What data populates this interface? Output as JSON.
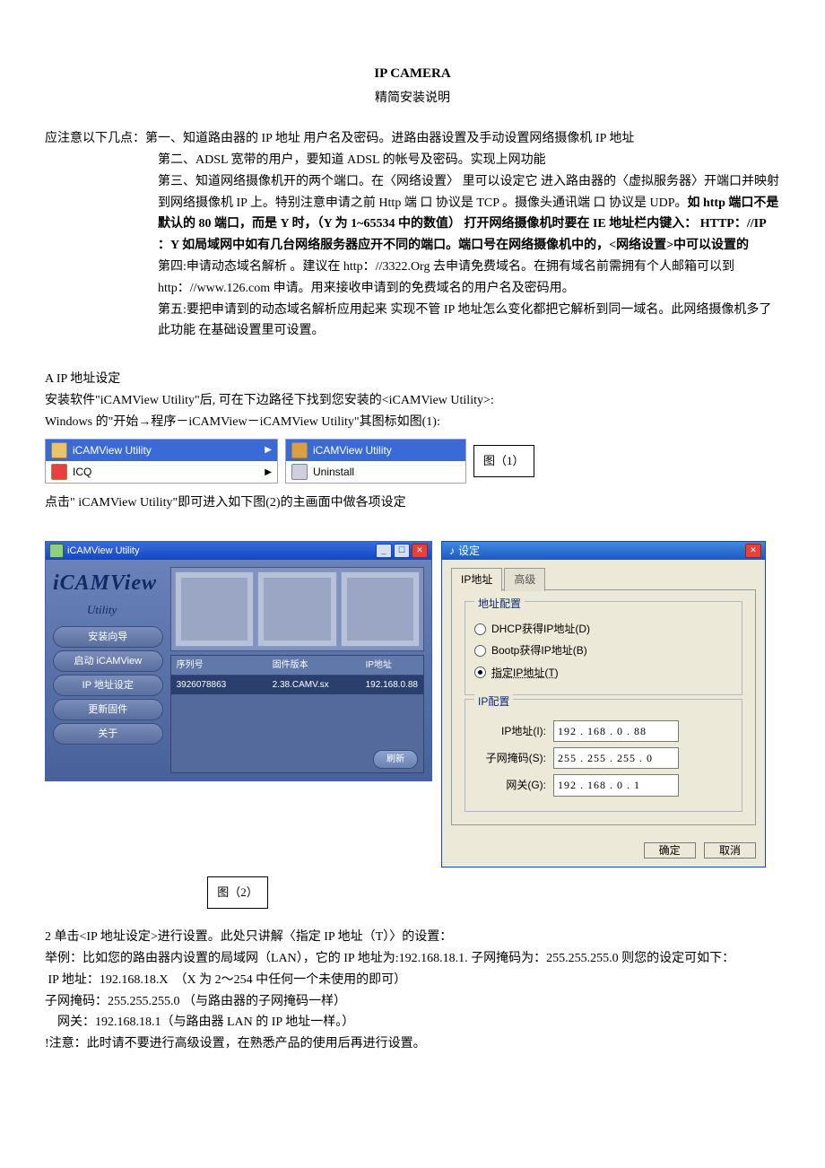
{
  "title": {
    "main": "IP CAMERA",
    "sub": "精简安装说明"
  },
  "notes": {
    "lead": "应注意以下几点：",
    "items": [
      {
        "prefix": "第一、",
        "text": "知道路由器的 IP 地址 用户名及密码。进路由器设置及手动设置网络摄像机 IP 地址"
      },
      {
        "prefix": "第二、",
        "text": "ADSL 宽带的用户，要知道 ADSL 的帐号及密码。实现上网功能"
      },
      {
        "prefix": "第三、",
        "text": "知道网络摄像机开的两个端口。在〈网络设置〉  里可以设定它 进入路由器的〈虚拟服务器〉开端口并映射到网络摄像机 IP 上。特别注意申请之前 Http 端 口 协议是 TCP 。摄像头通讯端 口 协议是 UDP。"
      },
      {
        "bold_tail": "如 http 端口不是默认的 80 端口，而是 Y 时，（Y 为 1~65534 中的数值）  打开网络摄像机时要在 IE 地址栏内键入：  HTTP：//IP ：Y 如局域网中如有几台网络服务器应开不同的端口。端口号在网络摄像机中的，<网络设置>中可以设置的"
      },
      {
        "prefix": "第四:",
        "text": "申请动态域名解析 。建议在 http：//3322.Org 去申请免费域名。在拥有域名前需拥有个人邮箱可以到 http：//www.126.com 申请。用来接收申请到的免费域名的用户名及密码用。"
      },
      {
        "prefix": "第五:",
        "text": "要把申请到的动态域名解析应用起来 实现不管 IP 地址怎么变化都把它解析到同一域名。此网络摄像机多了此功能 在基础设置里可设置。"
      }
    ]
  },
  "sectionA": {
    "heading": "A   IP 地址设定",
    "line1": "安装软件\"iCAMView Utility\"后,  可在下边路径下找到您安装的<iCAMView Utility>:",
    "line2": "Windows 的\"开始→程序－iCAMView－iCAMView Utility\"其图标如图(1):"
  },
  "menu1": {
    "left": [
      {
        "label": "iCAMView Utility",
        "arrow": true
      },
      {
        "label": "ICQ",
        "arrow": true
      }
    ],
    "right": [
      {
        "label": "iCAMView Utility"
      },
      {
        "label": "Uninstall"
      }
    ],
    "figlabel": "图（1）"
  },
  "afterFig1": "点击\" iCAMView Utility\"即可进入如下图(2)的主画面中做各项设定",
  "utility": {
    "title": "iCAMView Utility",
    "logo": "iCAMView",
    "logo_sub": "Utility",
    "buttons": [
      "安装向导",
      "启动 iCAMView",
      "IP 地址设定",
      "更新固件",
      "关于"
    ],
    "headers": [
      "序列号",
      "固件版本",
      "IP地址"
    ],
    "row": {
      "serial": "3926078863",
      "fw": "2.38.CAMV.sx",
      "ip": "192.168.0.88"
    },
    "refresh": "刷新"
  },
  "settings": {
    "title": "设定",
    "tab_ip": "IP地址",
    "tab_adv": "高级",
    "groupbox1": "地址配置",
    "opt_dhcp": "DHCP获得IP地址(D)",
    "opt_bootp": "Bootp获得IP地址(B)",
    "opt_static": "指定IP地址(T)",
    "groupbox2": "IP配置",
    "label_ip": "IP地址(I):",
    "val_ip": "192 . 168 .  0  .  88",
    "label_mask": "子网掩码(S):",
    "val_mask": "255 . 255 . 255 .  0",
    "label_gw": "网关(G):",
    "val_gw": "192 . 168 .  0  .   1",
    "ok": "确定",
    "cancel": "取消"
  },
  "fig2label": "图（2）",
  "body2": {
    "l1": "2 单击<IP 地址设定>进行设置。此处只讲解〈指定 IP 地址（T）〉的设置：",
    "l2": "举例：比如您的路由器内设置的局域网（LAN），它的 IP 地址为:192.168.18.1. 子网掩码为：255.255.255.0 则您的设定可如下：",
    "l3": " IP 地址：192.168.18.X  （X 为 2～254 中任何一个未使用的即可）",
    "l4": "子网掩码：255.255.255.0  （与路由器的子网掩码一样）",
    "l5": "    网关：192.168.18.1（与路由器 LAN 的 IP 地址一样。）",
    "l6": "!注意：此时请不要进行高级设置，在熟悉产品的使用后再进行设置。"
  }
}
